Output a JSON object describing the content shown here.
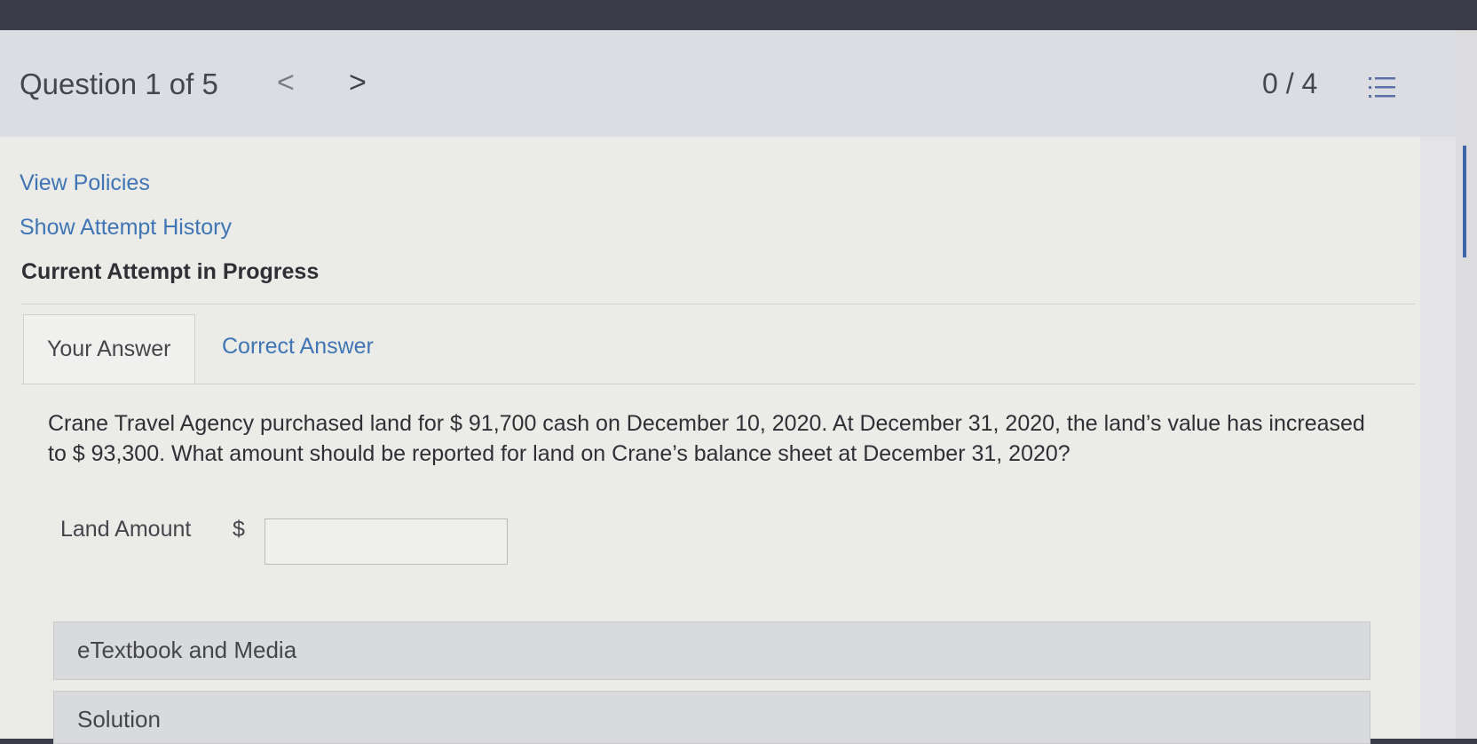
{
  "header": {
    "question_label": "Question 1 of 5",
    "prev_glyph": "<",
    "next_glyph": ">",
    "score": "0 / 4",
    "menu_icon": "list-icon"
  },
  "links": {
    "view_policies": "View Policies",
    "show_attempt_history": "Show Attempt History"
  },
  "attempt_status": "Current Attempt in Progress",
  "tabs": [
    {
      "label": "Your Answer",
      "active": true
    },
    {
      "label": "Correct Answer",
      "active": false
    }
  ],
  "question_text": "Crane Travel Agency purchased land for $ 91,700 cash on December 10, 2020. At December 31, 2020, the land’s value has increased to $ 93,300. What amount should be reported for land on Crane’s balance sheet at December 31, 2020?",
  "answer": {
    "label": "Land Amount",
    "currency": "$",
    "value": ""
  },
  "sections": [
    {
      "label": "eTextbook and Media"
    },
    {
      "label": "Solution"
    }
  ],
  "colors": {
    "link": "#3f75b4",
    "text": "#2f3035",
    "accent": "#3c66a8"
  }
}
